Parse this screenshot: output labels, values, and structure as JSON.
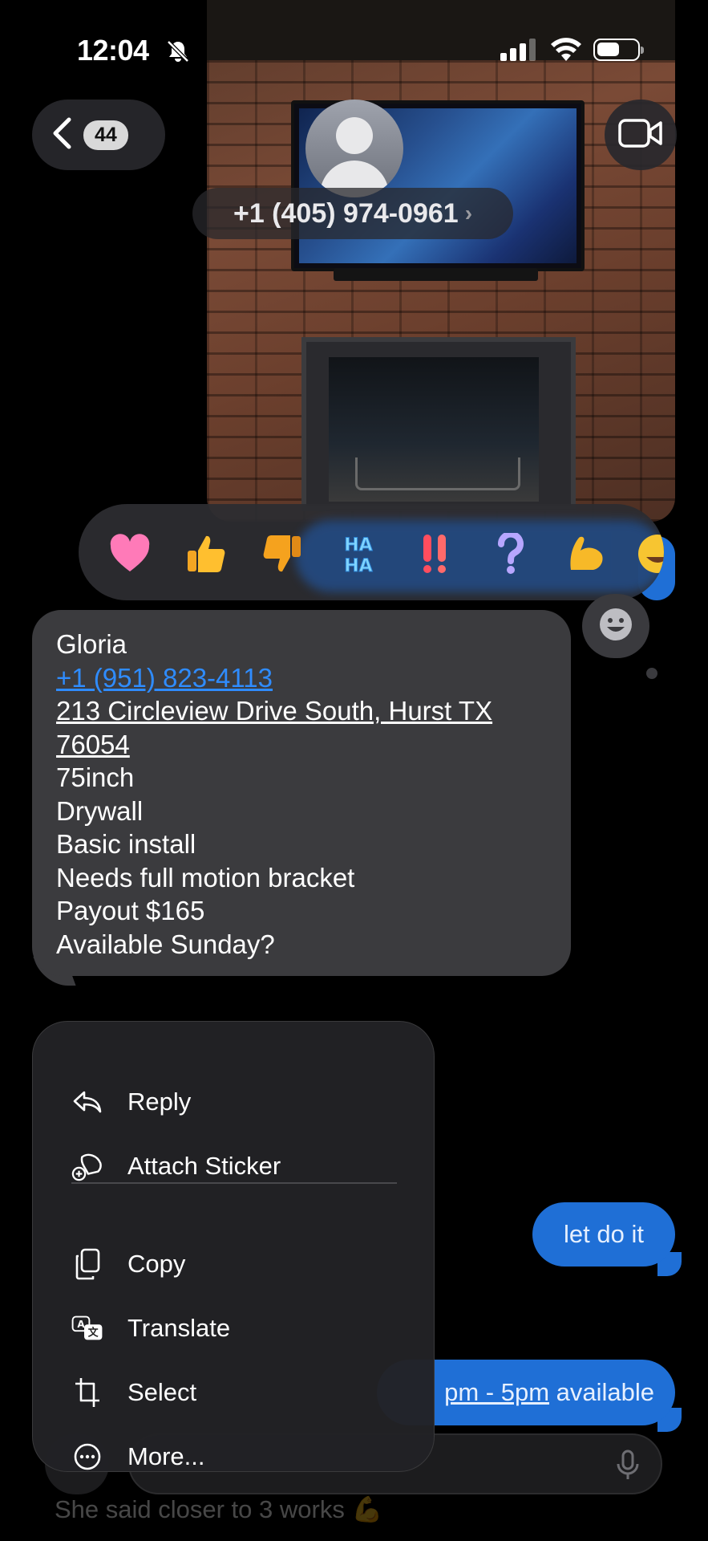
{
  "status_bar": {
    "time": "12:04"
  },
  "nav": {
    "back_count": "44",
    "contact": "+1 (405) 974-0961"
  },
  "tapbacks": [
    "heart",
    "thumbs-up",
    "thumbs-down",
    "haha",
    "exclamation",
    "question",
    "flexed-biceps",
    "laughing"
  ],
  "message": {
    "lines": [
      "Gloria",
      "+1 (951) 823-4113",
      "213 Circleview Drive South, Hurst TX",
      "76054",
      "75inch",
      "Drywall",
      "Basic install",
      "Needs full motion bracket",
      "Payout $165",
      "Available Sunday?"
    ]
  },
  "background_messages": {
    "sent_1": "let do it",
    "sent_2_link": "pm - 5pm",
    "sent_2_rest": " available",
    "received_faint": "She said closer to 3 works 💪"
  },
  "context_menu": {
    "items": [
      "Reply",
      "Attach Sticker",
      "Copy",
      "Translate",
      "Select",
      "More..."
    ]
  },
  "colors": {
    "imessage_blue": "#1f6fd6",
    "bubble_gray": "#3b3b3e",
    "link_blue": "#2f8cff"
  }
}
